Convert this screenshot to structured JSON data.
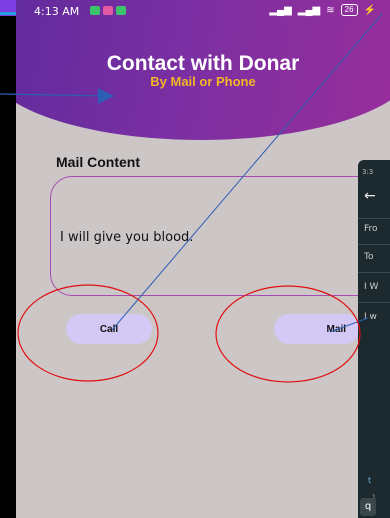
{
  "status_bar": {
    "time": "4:13 AM",
    "battery": "26"
  },
  "header": {
    "title": "Contact with Donar",
    "subtitle": "By Mail or Phone"
  },
  "mail": {
    "label": "Mail Content",
    "content": "I will give you blood."
  },
  "buttons": {
    "call_label": "Call",
    "mail_label": "Mail"
  },
  "overlay_panel": {
    "time": "3:3",
    "back_icon": "arrow-left-icon",
    "rows": [
      "Fro",
      "To",
      "I W",
      "I w"
    ],
    "keyboard_hint": "t",
    "key_label": "q",
    "key_number": "1"
  },
  "colors": {
    "header_start": "#5d2a9c",
    "header_end": "#9a2e9a",
    "subtitle": "#f3b526",
    "mail_border": "#a64bb5",
    "button_bg": "#d4c8f5",
    "annotation_red": "#e01010",
    "annotation_blue": "#2c5fb4"
  }
}
